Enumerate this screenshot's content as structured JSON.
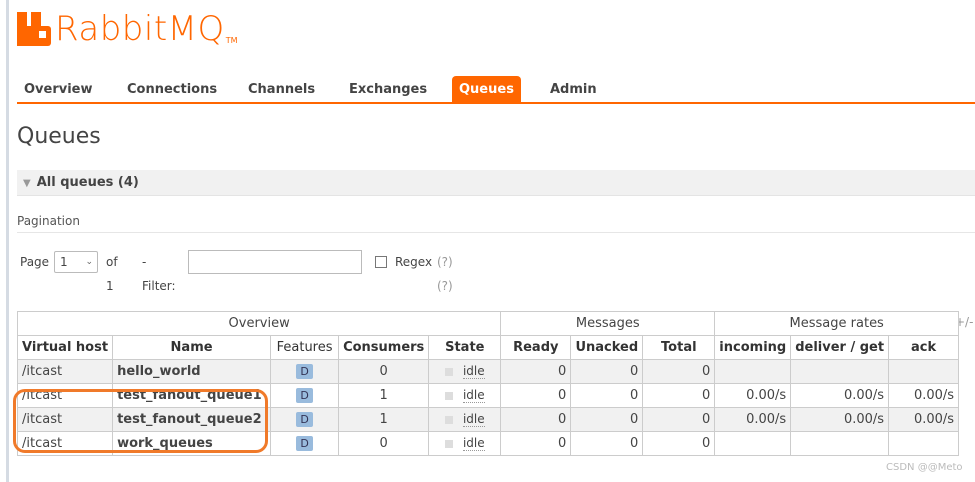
{
  "logo": {
    "text": "RabbitMQ",
    "tm": "TM"
  },
  "nav": {
    "items": [
      {
        "label": "Overview"
      },
      {
        "label": "Connections"
      },
      {
        "label": "Channels"
      },
      {
        "label": "Exchanges"
      },
      {
        "label": "Queues",
        "active": true
      },
      {
        "label": "Admin"
      }
    ]
  },
  "page": {
    "title": "Queues"
  },
  "section": {
    "label": "All queues (4)"
  },
  "pagination": {
    "label": "Pagination",
    "page_label": "Page",
    "page_value": "1",
    "of_label": "of 1",
    "filter_label": "- Filter:",
    "filter_value": "",
    "regex_label": "Regex",
    "help": "(?)(?)"
  },
  "table": {
    "groups": [
      "Overview",
      "Messages",
      "Message rates"
    ],
    "plusminus": "+/-",
    "columns": [
      "Virtual host",
      "Name",
      "Features",
      "Consumers",
      "State",
      "Ready",
      "Unacked",
      "Total",
      "incoming",
      "deliver / get",
      "ack"
    ],
    "rows": [
      {
        "vhost": "/itcast",
        "name": "hello_world",
        "feature": "D",
        "consumers": "0",
        "state": "idle",
        "ready": "0",
        "unacked": "0",
        "total": "0",
        "incoming": "",
        "deliver": "",
        "ack": ""
      },
      {
        "vhost": "/itcast",
        "name": "test_fanout_queue1",
        "feature": "D",
        "consumers": "1",
        "state": "idle",
        "ready": "0",
        "unacked": "0",
        "total": "0",
        "incoming": "0.00/s",
        "deliver": "0.00/s",
        "ack": "0.00/s"
      },
      {
        "vhost": "/itcast",
        "name": "test_fanout_queue2",
        "feature": "D",
        "consumers": "1",
        "state": "idle",
        "ready": "0",
        "unacked": "0",
        "total": "0",
        "incoming": "0.00/s",
        "deliver": "0.00/s",
        "ack": "0.00/s"
      },
      {
        "vhost": "/itcast",
        "name": "work_queues",
        "feature": "D",
        "consumers": "0",
        "state": "idle",
        "ready": "0",
        "unacked": "0",
        "total": "0",
        "incoming": "",
        "deliver": "",
        "ack": ""
      }
    ]
  },
  "watermark": "CSDN @@Meto",
  "colors": {
    "accent": "#ff6600",
    "annotation": "#f07a2a"
  }
}
